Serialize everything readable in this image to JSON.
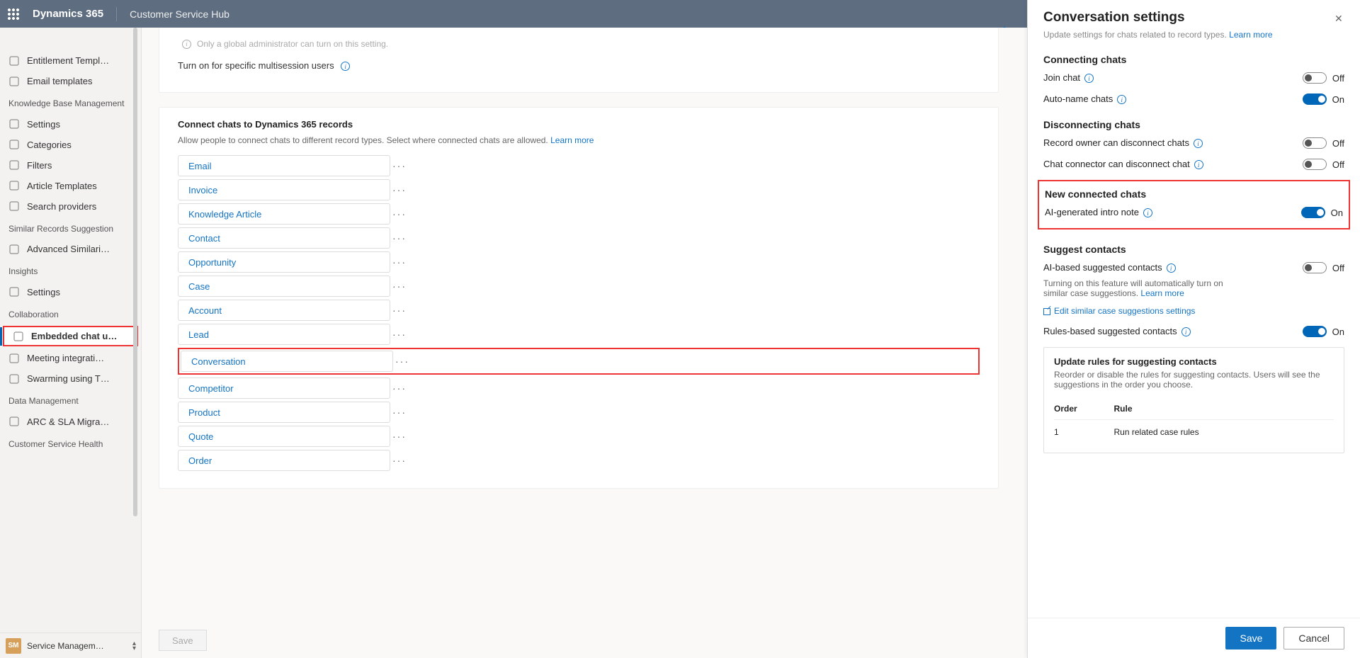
{
  "topbar": {
    "product": "Dynamics 365",
    "app": "Customer Service Hub"
  },
  "sidebar": {
    "items_top": [
      {
        "label": "Entitlement Templ…"
      },
      {
        "label": "Email templates"
      }
    ],
    "group1": "Knowledge Base Management",
    "kb_items": [
      {
        "label": "Settings"
      },
      {
        "label": "Categories"
      },
      {
        "label": "Filters"
      },
      {
        "label": "Article Templates"
      },
      {
        "label": "Search providers"
      }
    ],
    "group2": "Similar Records Suggestion",
    "sr_items": [
      {
        "label": "Advanced Similari…"
      }
    ],
    "group3": "Insights",
    "in_items": [
      {
        "label": "Settings"
      }
    ],
    "group4": "Collaboration",
    "co_items": [
      {
        "label": "Embedded chat u…",
        "active": true
      },
      {
        "label": "Meeting integrati…"
      },
      {
        "label": "Swarming using T…"
      }
    ],
    "group5": "Data Management",
    "dm_items": [
      {
        "label": "ARC & SLA Migra…"
      }
    ],
    "group6": "Customer Service Health"
  },
  "area": {
    "badge": "SM",
    "label": "Service Managem…"
  },
  "card1": {
    "note": "Only a global administrator can turn on this setting.",
    "row": "Turn on for specific multisession users"
  },
  "card2": {
    "title": "Connect chats to Dynamics 365 records",
    "sub": "Allow people to connect chats to different record types. Select where connected chats are allowed.",
    "learn": "Learn more",
    "records": [
      "Email",
      "Invoice",
      "Knowledge Article",
      "Contact",
      "Opportunity",
      "Case",
      "Account",
      "Lead",
      "Conversation",
      "Competitor",
      "Product",
      "Quote",
      "Order"
    ]
  },
  "save_label": "Save",
  "panel": {
    "title": "Conversation settings",
    "cut": "Update settings for chats related to record types.",
    "cut_link": "Learn more",
    "s_conn": "Connecting chats",
    "r_join": "Join chat",
    "v_join": "Off",
    "r_auto": "Auto-name chats",
    "v_auto": "On",
    "s_disc": "Disconnecting chats",
    "r_owner": "Record owner can disconnect chats",
    "v_owner": "Off",
    "r_connchat": "Chat connector can disconnect chat",
    "v_connchat": "Off",
    "s_new": "New connected chats",
    "r_intro": "AI-generated intro note",
    "v_intro": "On",
    "s_sug": "Suggest contacts",
    "r_ai": "AI-based suggested contacts",
    "v_ai": "Off",
    "ai_note": "Turning on this feature will automatically turn on similar case suggestions.",
    "ai_learn": "Learn more",
    "ai_edit": "Edit similar case suggestions settings",
    "r_rule": "Rules-based suggested contacts",
    "v_rule": "On",
    "rules": {
      "title": "Update rules for suggesting contacts",
      "desc": "Reorder or disable the rules for suggesting contacts. Users will see the suggestions in the order you choose.",
      "h1": "Order",
      "h2": "Rule",
      "rows": [
        {
          "order": "1",
          "rule": "Run related case rules"
        }
      ]
    },
    "save": "Save",
    "cancel": "Cancel"
  }
}
